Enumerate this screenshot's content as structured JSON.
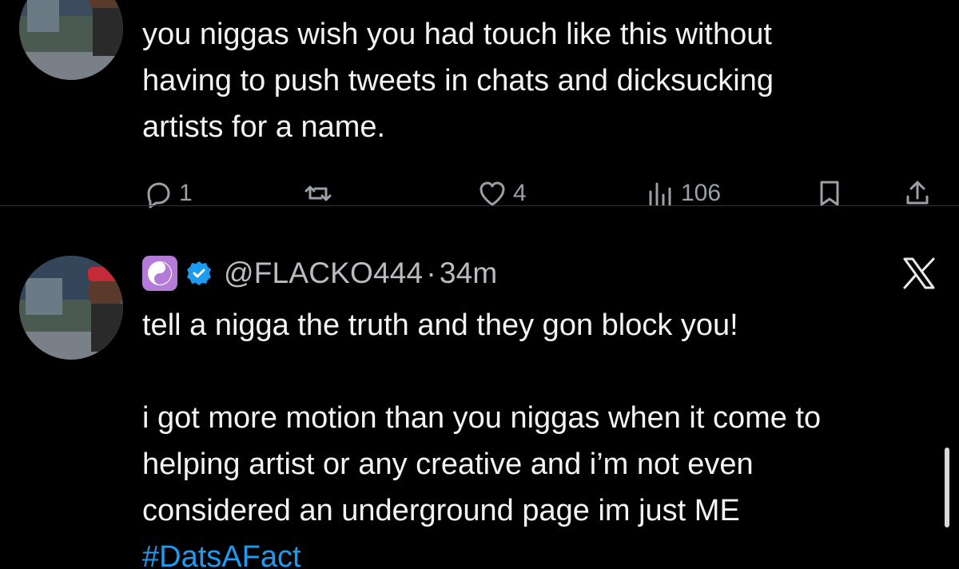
{
  "tweets": [
    {
      "text": "you niggas wish you had touch like this without\nhaving to push tweets in chats and dicksucking\nartists for a name.",
      "actions": {
        "replies": "1",
        "reposts": "",
        "likes": "4",
        "views": "106"
      }
    },
    {
      "handle": "@FLACKO444",
      "separator": "·",
      "time": "34m",
      "text": "tell a nigga the truth and they gon block you!\n\ni got more motion than you niggas when it come to\nhelping artist or any creative and i’m not even\nconsidered an underground page im just ME",
      "hashtag": "#DatsAFact"
    }
  ],
  "colors": {
    "background": "#000000",
    "text": "#f2f3f4",
    "muted": "#9aa0a6",
    "link": "#1d9bf0",
    "verified": "#1d9bf0",
    "emoji_badge": "#b57bd9"
  },
  "icons": {
    "reply": "speech-bubble-icon",
    "repost": "repost-arrows-icon",
    "like": "heart-icon",
    "views": "bar-chart-icon",
    "bookmark": "bookmark-icon",
    "share": "share-upload-icon",
    "platform": "x-logo-icon",
    "badge": "yin-yang-icon",
    "verified": "verified-check-icon"
  }
}
